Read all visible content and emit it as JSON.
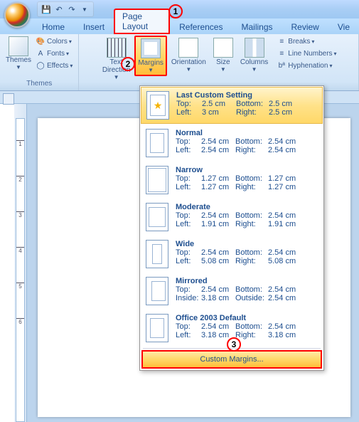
{
  "qat": {
    "save": "💾",
    "undo": "↶",
    "redo": "↷"
  },
  "tabs": {
    "home": "Home",
    "insert": "Insert",
    "page_layout": "Page Layout",
    "references": "References",
    "mailings": "Mailings",
    "review": "Review",
    "view": "Vie"
  },
  "themes": {
    "label": "Themes",
    "colors": "Colors",
    "fonts": "Fonts",
    "effects": "Effects",
    "group": "Themes"
  },
  "page_setup": {
    "text_direction": "Text\nDirection",
    "margins": "Margins",
    "orientation": "Orientation",
    "size": "Size",
    "columns": "Columns",
    "breaks": "Breaks",
    "line_numbers": "Line Numbers",
    "hyphenation": "Hyphenation"
  },
  "circles": {
    "c1": "1",
    "c2": "2",
    "c3": "3"
  },
  "ruler": {
    "t1": "1",
    "t2": "2",
    "t3": "3",
    "t4": "4",
    "t5": "5",
    "t6": "6"
  },
  "dd": {
    "last": {
      "title": "Last Custom Setting",
      "top_l": "Top:",
      "top_v": "2.5 cm",
      "bot_l": "Bottom:",
      "bot_v": "2.5 cm",
      "left_l": "Left:",
      "left_v": "3 cm",
      "right_l": "Right:",
      "right_v": "2.5 cm"
    },
    "normal": {
      "title": "Normal",
      "top_l": "Top:",
      "top_v": "2.54 cm",
      "bot_l": "Bottom:",
      "bot_v": "2.54 cm",
      "left_l": "Left:",
      "left_v": "2.54 cm",
      "right_l": "Right:",
      "right_v": "2.54 cm"
    },
    "narrow": {
      "title": "Narrow",
      "top_l": "Top:",
      "top_v": "1.27 cm",
      "bot_l": "Bottom:",
      "bot_v": "1.27 cm",
      "left_l": "Left:",
      "left_v": "1.27 cm",
      "right_l": "Right:",
      "right_v": "1.27 cm"
    },
    "moderate": {
      "title": "Moderate",
      "top_l": "Top:",
      "top_v": "2.54 cm",
      "bot_l": "Bottom:",
      "bot_v": "2.54 cm",
      "left_l": "Left:",
      "left_v": "1.91 cm",
      "right_l": "Right:",
      "right_v": "1.91 cm"
    },
    "wide": {
      "title": "Wide",
      "top_l": "Top:",
      "top_v": "2.54 cm",
      "bot_l": "Bottom:",
      "bot_v": "2.54 cm",
      "left_l": "Left:",
      "left_v": "5.08 cm",
      "right_l": "Right:",
      "right_v": "5.08 cm"
    },
    "mirrored": {
      "title": "Mirrored",
      "top_l": "Top:",
      "top_v": "2.54 cm",
      "bot_l": "Bottom:",
      "bot_v": "2.54 cm",
      "left_l": "Inside:",
      "left_v": "3.18 cm",
      "right_l": "Outside:",
      "right_v": "2.54 cm"
    },
    "office2003": {
      "title": "Office 2003 Default",
      "top_l": "Top:",
      "top_v": "2.54 cm",
      "bot_l": "Bottom:",
      "bot_v": "2.54 cm",
      "left_l": "Left:",
      "left_v": "3.18 cm",
      "right_l": "Right:",
      "right_v": "3.18 cm"
    },
    "custom": "Custom Margins..."
  }
}
